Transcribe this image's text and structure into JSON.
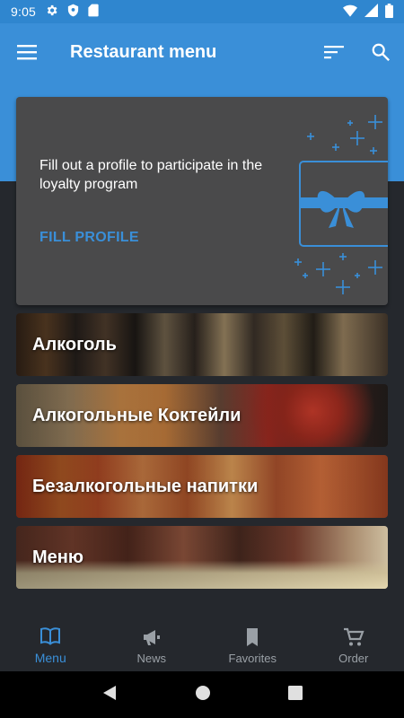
{
  "status_bar": {
    "time": "9:05",
    "left_icons": [
      "gear-icon",
      "shield-icon",
      "sd-card-icon"
    ],
    "right_icons": [
      "wifi-icon",
      "signal-icon",
      "battery-icon"
    ]
  },
  "app_bar": {
    "title": "Restaurant menu",
    "left_icon": "hamburger-menu-icon",
    "actions": [
      "sort-icon",
      "search-icon"
    ]
  },
  "promo_card": {
    "text": "Fill out a profile to participate in the loyalty program",
    "action_label": "FILL PROFILE",
    "art": "gift-box-with-sparkles"
  },
  "categories": [
    {
      "label": "Алкоголь"
    },
    {
      "label": "Алкогольные Коктейли"
    },
    {
      "label": "Безалкогольные напитки"
    },
    {
      "label": "Меню"
    }
  ],
  "bottom_nav": {
    "items": [
      {
        "label": "Menu",
        "icon": "book-icon",
        "active": true
      },
      {
        "label": "News",
        "icon": "megaphone-icon",
        "active": false
      },
      {
        "label": "Favorites",
        "icon": "bookmark-icon",
        "active": false
      },
      {
        "label": "Order",
        "icon": "cart-icon",
        "active": false
      }
    ]
  },
  "system_nav": [
    "back-icon",
    "home-icon",
    "recents-icon"
  ],
  "colors": {
    "accent": "#3a8fd8",
    "background": "#25282d",
    "card": "#4a4a4b",
    "nav_inactive": "#9aa0a6"
  }
}
